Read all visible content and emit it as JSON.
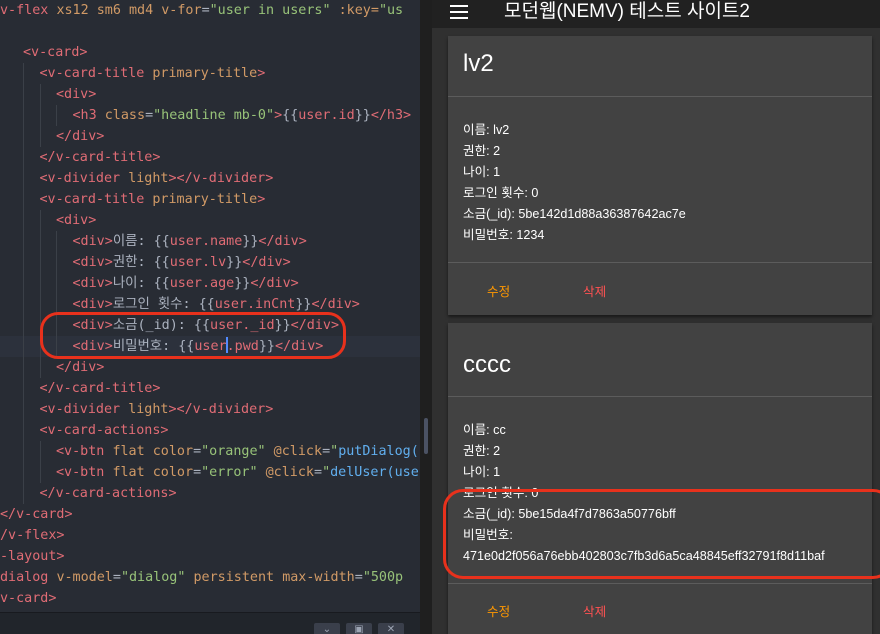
{
  "editor": {
    "lines": [
      [
        {
          "t": "v-flex ",
          "c": "tok-tag"
        },
        {
          "t": "xs12 sm6 md4 ",
          "c": "tok-attr"
        },
        {
          "t": "v-for",
          "c": "tok-attr"
        },
        {
          "t": "=",
          "c": "tok-plain"
        },
        {
          "t": "\"user in users\"",
          "c": "tok-str"
        },
        {
          "t": " :key=",
          "c": "tok-attr"
        },
        {
          "t": "\"us",
          "c": "tok-str"
        }
      ],
      [],
      [
        {
          "t": "<v-card>",
          "c": "tok-tag"
        }
      ],
      [
        {
          "t": "<v-card-title ",
          "c": "tok-tag"
        },
        {
          "t": "primary-title",
          "c": "tok-attr"
        },
        {
          "t": ">",
          "c": "tok-tag"
        }
      ],
      [
        {
          "t": "<div>",
          "c": "tok-tag"
        }
      ],
      [
        {
          "t": "<h3 ",
          "c": "tok-tag"
        },
        {
          "t": "class",
          "c": "tok-attr"
        },
        {
          "t": "=",
          "c": "tok-plain"
        },
        {
          "t": "\"headline mb-0\"",
          "c": "tok-str"
        },
        {
          "t": ">",
          "c": "tok-tag"
        },
        {
          "t": "{{",
          "c": "tok-plain"
        },
        {
          "t": "user.id",
          "c": "tok-tag"
        },
        {
          "t": "}}",
          "c": "tok-plain"
        },
        {
          "t": "</h3>",
          "c": "tok-tag"
        }
      ],
      [
        {
          "t": "</div>",
          "c": "tok-tag"
        }
      ],
      [
        {
          "t": "</v-card-title>",
          "c": "tok-tag"
        }
      ],
      [
        {
          "t": "<v-divider ",
          "c": "tok-tag"
        },
        {
          "t": "light",
          "c": "tok-attr"
        },
        {
          "t": "></v-divider>",
          "c": "tok-tag"
        }
      ],
      [
        {
          "t": "<v-card-title ",
          "c": "tok-tag"
        },
        {
          "t": "primary-title",
          "c": "tok-attr"
        },
        {
          "t": ">",
          "c": "tok-tag"
        }
      ],
      [
        {
          "t": "<div>",
          "c": "tok-tag"
        }
      ],
      [
        {
          "t": "<div>",
          "c": "tok-tag"
        },
        {
          "t": "이름: {{",
          "c": "tok-plain"
        },
        {
          "t": "user.name",
          "c": "tok-tag"
        },
        {
          "t": "}}",
          "c": "tok-plain"
        },
        {
          "t": "</div>",
          "c": "tok-tag"
        }
      ],
      [
        {
          "t": "<div>",
          "c": "tok-tag"
        },
        {
          "t": "권한: {{",
          "c": "tok-plain"
        },
        {
          "t": "user.lv",
          "c": "tok-tag"
        },
        {
          "t": "}}",
          "c": "tok-plain"
        },
        {
          "t": "</div>",
          "c": "tok-tag"
        }
      ],
      [
        {
          "t": "<div>",
          "c": "tok-tag"
        },
        {
          "t": "나이: {{",
          "c": "tok-plain"
        },
        {
          "t": "user.age",
          "c": "tok-tag"
        },
        {
          "t": "}}",
          "c": "tok-plain"
        },
        {
          "t": "</div>",
          "c": "tok-tag"
        }
      ],
      [
        {
          "t": "<div>",
          "c": "tok-tag"
        },
        {
          "t": "로그인 횟수: {{",
          "c": "tok-plain"
        },
        {
          "t": "user.inCnt",
          "c": "tok-tag"
        },
        {
          "t": "}}",
          "c": "tok-plain"
        },
        {
          "t": "</div>",
          "c": "tok-tag"
        }
      ],
      [
        {
          "t": "<div>",
          "c": "tok-tag"
        },
        {
          "t": "소금(_id): {{",
          "c": "tok-plain"
        },
        {
          "t": "user._id",
          "c": "tok-tag"
        },
        {
          "t": "}}",
          "c": "tok-plain"
        },
        {
          "t": "</div>",
          "c": "tok-tag"
        }
      ],
      [
        {
          "t": "<div>",
          "c": "tok-tag"
        },
        {
          "t": "비밀번호: {{",
          "c": "tok-plain"
        },
        {
          "t": "user",
          "c": "tok-tag"
        },
        {
          "t": "|",
          "c": "cursor"
        },
        {
          "t": ".pwd",
          "c": "tok-tag"
        },
        {
          "t": "}}",
          "c": "tok-plain"
        },
        {
          "t": "</div>",
          "c": "tok-tag"
        }
      ],
      [
        {
          "t": "</div>",
          "c": "tok-tag"
        }
      ],
      [
        {
          "t": "</v-card-title>",
          "c": "tok-tag"
        }
      ],
      [
        {
          "t": "<v-divider ",
          "c": "tok-tag"
        },
        {
          "t": "light",
          "c": "tok-attr"
        },
        {
          "t": "></v-divider>",
          "c": "tok-tag"
        }
      ],
      [
        {
          "t": "<v-card-actions>",
          "c": "tok-tag"
        }
      ],
      [
        {
          "t": "<v-btn ",
          "c": "tok-tag"
        },
        {
          "t": "flat color",
          "c": "tok-attr"
        },
        {
          "t": "=",
          "c": "tok-plain"
        },
        {
          "t": "\"orange\"",
          "c": "tok-str"
        },
        {
          "t": " @click",
          "c": "tok-attr"
        },
        {
          "t": "=",
          "c": "tok-plain"
        },
        {
          "t": "\"",
          "c": "tok-str"
        },
        {
          "t": "putDialog(",
          "c": "tok-fn"
        }
      ],
      [
        {
          "t": "<v-btn ",
          "c": "tok-tag"
        },
        {
          "t": "flat color",
          "c": "tok-attr"
        },
        {
          "t": "=",
          "c": "tok-plain"
        },
        {
          "t": "\"error\"",
          "c": "tok-str"
        },
        {
          "t": " @click",
          "c": "tok-attr"
        },
        {
          "t": "=",
          "c": "tok-plain"
        },
        {
          "t": "\"",
          "c": "tok-str"
        },
        {
          "t": "delUser(use",
          "c": "tok-fn"
        }
      ],
      [
        {
          "t": "</v-card-actions>",
          "c": "tok-tag"
        }
      ],
      [
        {
          "t": "</v-card>",
          "c": "tok-tag"
        }
      ],
      [
        {
          "t": "/v-flex>",
          "c": "tok-tag"
        }
      ],
      [
        {
          "t": "-layout>",
          "c": "tok-tag"
        }
      ],
      [
        {
          "t": "dialog ",
          "c": "tok-tag"
        },
        {
          "t": "v-model",
          "c": "tok-attr"
        },
        {
          "t": "=",
          "c": "tok-plain"
        },
        {
          "t": "\"dialog\"",
          "c": "tok-str"
        },
        {
          "t": " persistent ",
          "c": "tok-attr"
        },
        {
          "t": "max-width",
          "c": "tok-attr"
        },
        {
          "t": "=",
          "c": "tok-plain"
        },
        {
          "t": "\"500p",
          "c": "tok-str"
        }
      ],
      [
        {
          "t": "v-card>",
          "c": "tok-tag"
        }
      ]
    ],
    "indents": [
      0,
      0,
      1,
      2,
      3,
      4,
      3,
      2,
      2,
      2,
      3,
      4,
      4,
      4,
      4,
      4,
      4,
      3,
      2,
      2,
      2,
      3,
      3,
      2,
      1,
      0,
      0,
      0,
      0
    ]
  },
  "app": {
    "title": "모던웹(NEMV) 테스트 사이트2",
    "cards": [
      {
        "id": "lv2",
        "fields": [
          "이름: lv2",
          "권한: 2",
          "나이: 1",
          "로그인 횟수: 0",
          "소금(_id): 5be142d1d88a36387642ac7e",
          "비밀번호: 1234"
        ],
        "edit_label": "수정",
        "delete_label": "삭제"
      },
      {
        "id": "cccc",
        "fields": [
          "이름: cc",
          "권한: 2",
          "나이: 1",
          "로그인 횟수: 0",
          "소금(_id): 5be15da4f7d7863a50776bff",
          "비밀번호:",
          "471e0d2f056a76ebb402803c7fb3d6a5ca48845eff32791f8d11baf"
        ],
        "edit_label": "수정",
        "delete_label": "삭제"
      }
    ]
  },
  "colors": {
    "highlight": "#e8311c",
    "accent_orange": "#ff9800",
    "accent_red": "#ff5252"
  }
}
